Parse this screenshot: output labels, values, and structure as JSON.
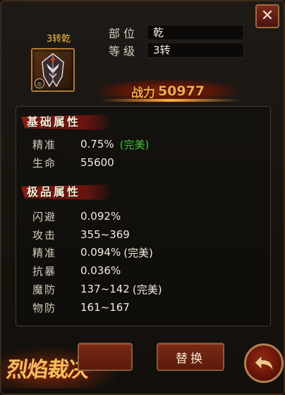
{
  "close": {
    "icon": "close-icon",
    "glyph": "✕"
  },
  "item": {
    "name": "3转乾",
    "icon": "helmet-icon"
  },
  "info": [
    {
      "label": "部位",
      "value": "乾"
    },
    {
      "label": "等级",
      "value": "3转"
    }
  ],
  "power": {
    "label": "战力",
    "value": "50977"
  },
  "basic": {
    "title": "基础属性",
    "stats": [
      {
        "label": "精准",
        "value": "0.75%",
        "perfect": "(完美)"
      },
      {
        "label": "生命",
        "value": "55600",
        "perfect": ""
      }
    ]
  },
  "premium": {
    "title": "极品属性",
    "stats": [
      {
        "label": "闪避",
        "value": "0.092%",
        "suffix": ""
      },
      {
        "label": "攻击",
        "value": "355~369",
        "suffix": ""
      },
      {
        "label": "精准",
        "value": "0.094%",
        "suffix": "(完美)"
      },
      {
        "label": "抗暴",
        "value": "0.036%",
        "suffix": ""
      },
      {
        "label": "魔防",
        "value": "137~142",
        "suffix": "(完美)"
      },
      {
        "label": "物防",
        "value": "161~167",
        "suffix": ""
      }
    ]
  },
  "buttons": {
    "replace": "替换",
    "back_icon": "back-arrow-icon"
  },
  "logo": {
    "text": "烈焰裁决"
  },
  "colors": {
    "accent": "#f4a848",
    "perfect": "#3cc43c",
    "item_name": "#f0c040"
  }
}
